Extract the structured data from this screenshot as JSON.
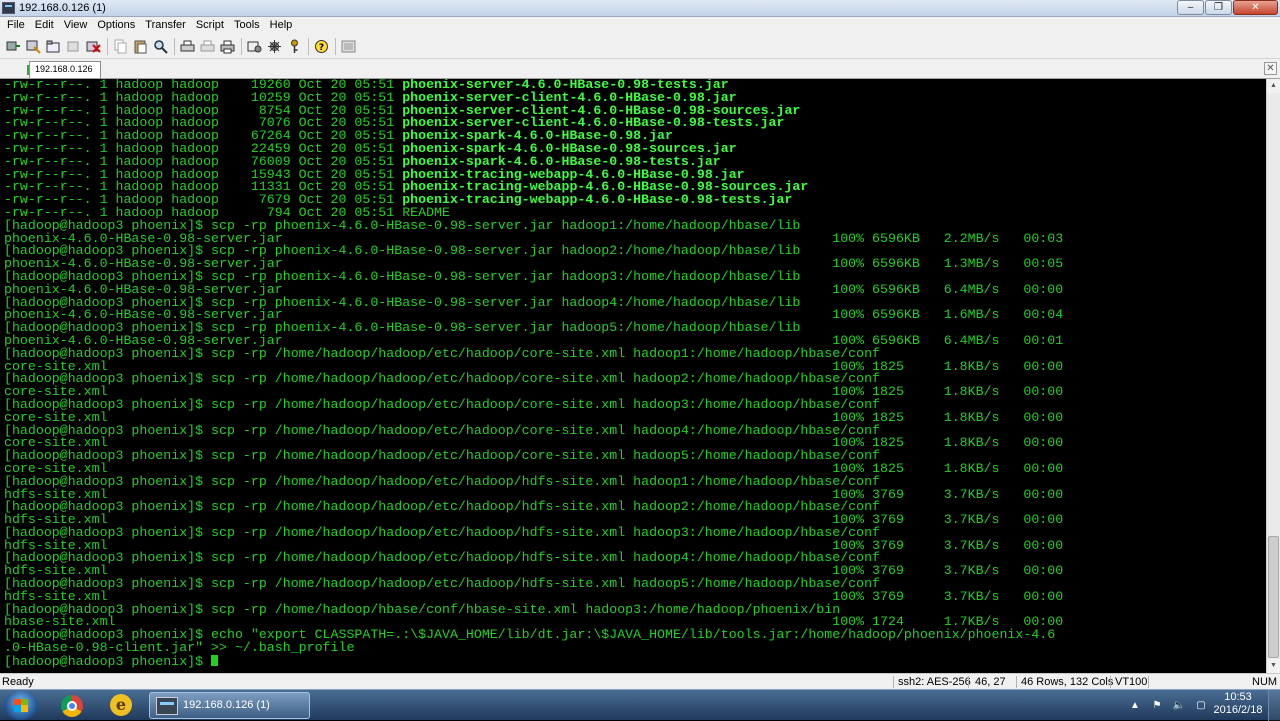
{
  "window": {
    "title": "192.168.0.126 (1)"
  },
  "menu": [
    "File",
    "Edit",
    "View",
    "Options",
    "Transfer",
    "Script",
    "Tools",
    "Help"
  ],
  "toolbar": {
    "buttons": [
      "connect-icon",
      "quick-connect-icon",
      "connect-tab-icon",
      "reconnect-icon",
      "disconnect-icon",
      "copy-icon",
      "paste-icon",
      "find-icon",
      "print-setup-icon",
      "print-selection-icon",
      "print-icon",
      "session-options-icon",
      "global-options-icon",
      "keymap-icon",
      "help-icon",
      "sftp-icon"
    ]
  },
  "tab": {
    "label": "192.168.0.126 (1)"
  },
  "terminal": {
    "ls_lines": [
      {
        "prefix": "-rw-r--r--. 1 hadoop hadoop    19260 Oct 20 05:51 ",
        "file": "phoenix-server-4.6.0-HBase-0.98-tests.jar"
      },
      {
        "prefix": "-rw-r--r--. 1 hadoop hadoop    10259 Oct 20 05:51 ",
        "file": "phoenix-server-client-4.6.0-HBase-0.98.jar"
      },
      {
        "prefix": "-rw-r--r--. 1 hadoop hadoop     8754 Oct 20 05:51 ",
        "file": "phoenix-server-client-4.6.0-HBase-0.98-sources.jar"
      },
      {
        "prefix": "-rw-r--r--. 1 hadoop hadoop     7076 Oct 20 05:51 ",
        "file": "phoenix-server-client-4.6.0-HBase-0.98-tests.jar"
      },
      {
        "prefix": "-rw-r--r--. 1 hadoop hadoop    67264 Oct 20 05:51 ",
        "file": "phoenix-spark-4.6.0-HBase-0.98.jar"
      },
      {
        "prefix": "-rw-r--r--. 1 hadoop hadoop    22459 Oct 20 05:51 ",
        "file": "phoenix-spark-4.6.0-HBase-0.98-sources.jar"
      },
      {
        "prefix": "-rw-r--r--. 1 hadoop hadoop    76009 Oct 20 05:51 ",
        "file": "phoenix-spark-4.6.0-HBase-0.98-tests.jar"
      },
      {
        "prefix": "-rw-r--r--. 1 hadoop hadoop    15943 Oct 20 05:51 ",
        "file": "phoenix-tracing-webapp-4.6.0-HBase-0.98.jar"
      },
      {
        "prefix": "-rw-r--r--. 1 hadoop hadoop    11331 Oct 20 05:51 ",
        "file": "phoenix-tracing-webapp-4.6.0-HBase-0.98-sources.jar"
      },
      {
        "prefix": "-rw-r--r--. 1 hadoop hadoop     7679 Oct 20 05:51 ",
        "file": "phoenix-tracing-webapp-4.6.0-HBase-0.98-tests.jar"
      },
      {
        "prefix": "-rw-r--r--. 1 hadoop hadoop      794 Oct 20 05:51 ",
        "file": "",
        "plain": "README"
      }
    ],
    "lines": [
      "[hadoop@hadoop3 phoenix]$ scp -rp phoenix-4.6.0-HBase-0.98-server.jar hadoop1:/home/hadoop/hbase/lib",
      "phoenix-4.6.0-HBase-0.98-server.jar                                                                     100% 6596KB   2.2MB/s   00:03",
      "[hadoop@hadoop3 phoenix]$ scp -rp phoenix-4.6.0-HBase-0.98-server.jar hadoop2:/home/hadoop/hbase/lib",
      "phoenix-4.6.0-HBase-0.98-server.jar                                                                     100% 6596KB   1.3MB/s   00:05",
      "[hadoop@hadoop3 phoenix]$ scp -rp phoenix-4.6.0-HBase-0.98-server.jar hadoop3:/home/hadoop/hbase/lib",
      "phoenix-4.6.0-HBase-0.98-server.jar                                                                     100% 6596KB   6.4MB/s   00:00",
      "[hadoop@hadoop3 phoenix]$ scp -rp phoenix-4.6.0-HBase-0.98-server.jar hadoop4:/home/hadoop/hbase/lib",
      "phoenix-4.6.0-HBase-0.98-server.jar                                                                     100% 6596KB   1.6MB/s   00:04",
      "[hadoop@hadoop3 phoenix]$ scp -rp phoenix-4.6.0-HBase-0.98-server.jar hadoop5:/home/hadoop/hbase/lib",
      "phoenix-4.6.0-HBase-0.98-server.jar                                                                     100% 6596KB   6.4MB/s   00:01",
      "[hadoop@hadoop3 phoenix]$ scp -rp /home/hadoop/hadoop/etc/hadoop/core-site.xml hadoop1:/home/hadoop/hbase/conf",
      "core-site.xml                                                                                           100% 1825     1.8KB/s   00:00",
      "[hadoop@hadoop3 phoenix]$ scp -rp /home/hadoop/hadoop/etc/hadoop/core-site.xml hadoop2:/home/hadoop/hbase/conf",
      "core-site.xml                                                                                           100% 1825     1.8KB/s   00:00",
      "[hadoop@hadoop3 phoenix]$ scp -rp /home/hadoop/hadoop/etc/hadoop/core-site.xml hadoop3:/home/hadoop/hbase/conf",
      "core-site.xml                                                                                           100% 1825     1.8KB/s   00:00",
      "[hadoop@hadoop3 phoenix]$ scp -rp /home/hadoop/hadoop/etc/hadoop/core-site.xml hadoop4:/home/hadoop/hbase/conf",
      "core-site.xml                                                                                           100% 1825     1.8KB/s   00:00",
      "[hadoop@hadoop3 phoenix]$ scp -rp /home/hadoop/hadoop/etc/hadoop/core-site.xml hadoop5:/home/hadoop/hbase/conf",
      "core-site.xml                                                                                           100% 1825     1.8KB/s   00:00",
      "[hadoop@hadoop3 phoenix]$ scp -rp /home/hadoop/hadoop/etc/hadoop/hdfs-site.xml hadoop1:/home/hadoop/hbase/conf",
      "hdfs-site.xml                                                                                           100% 3769     3.7KB/s   00:00",
      "[hadoop@hadoop3 phoenix]$ scp -rp /home/hadoop/hadoop/etc/hadoop/hdfs-site.xml hadoop2:/home/hadoop/hbase/conf",
      "hdfs-site.xml                                                                                           100% 3769     3.7KB/s   00:00",
      "[hadoop@hadoop3 phoenix]$ scp -rp /home/hadoop/hadoop/etc/hadoop/hdfs-site.xml hadoop3:/home/hadoop/hbase/conf",
      "hdfs-site.xml                                                                                           100% 3769     3.7KB/s   00:00",
      "[hadoop@hadoop3 phoenix]$ scp -rp /home/hadoop/hadoop/etc/hadoop/hdfs-site.xml hadoop4:/home/hadoop/hbase/conf",
      "hdfs-site.xml                                                                                           100% 3769     3.7KB/s   00:00",
      "[hadoop@hadoop3 phoenix]$ scp -rp /home/hadoop/hadoop/etc/hadoop/hdfs-site.xml hadoop5:/home/hadoop/hbase/conf",
      "hdfs-site.xml                                                                                           100% 3769     3.7KB/s   00:00",
      "[hadoop@hadoop3 phoenix]$ scp -rp /home/hadoop/hbase/conf/hbase-site.xml hadoop3:/home/hadoop/phoenix/bin",
      "hbase-site.xml                                                                                          100% 1724     1.7KB/s   00:00",
      "[hadoop@hadoop3 phoenix]$ echo \"export CLASSPATH=.:\\$JAVA_HOME/lib/dt.jar:\\$JAVA_HOME/lib/tools.jar:/home/hadoop/phoenix/phoenix-4.6",
      ".0-HBase-0.98-client.jar\" >> ~/.bash_profile"
    ],
    "prompt": "[hadoop@hadoop3 phoenix]$ "
  },
  "status": {
    "left": "Ready",
    "cipher": "ssh2: AES-256",
    "cursor": "46,  27",
    "size": "46 Rows, 132 Cols",
    "emulation": "VT100",
    "num": "NUM"
  },
  "taskbar": {
    "app_label": "192.168.0.126 (1)",
    "time": "10:53",
    "date": "2016/2/18"
  },
  "colors": {
    "terminal_fg": "#1fd41f",
    "filename_fg": "#3cff3c",
    "terminal_bg": "#000000"
  }
}
